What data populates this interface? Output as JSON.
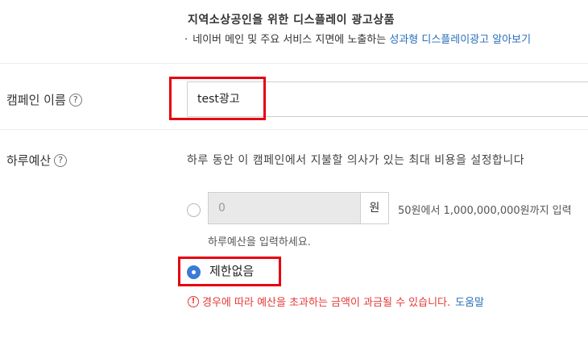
{
  "ad_product": {
    "title": "지역소상공인을 위한 디스플레이 광고상품",
    "desc_prefix": "네이버 메인 및 주요 서비스 지면에 노출하는",
    "desc_link": "성과형 디스플레이광고 알아보기"
  },
  "campaign_name": {
    "label": "캠페인 이름",
    "help": "?",
    "value": "test광고"
  },
  "daily_budget": {
    "label": "하루예산",
    "help": "?",
    "description": "하루 동안 이 캠페인에서 지불할 의사가 있는 최대 비용을 설정합니다",
    "amount_value": "0",
    "unit": "원",
    "range_hint": "50원에서 1,000,000,000원까지 입력",
    "input_hint": "하루예산을 입력하세요.",
    "unlimited_label": "제한없음",
    "unlimited_selected": true,
    "warning_text": "경우에 따라 예산을 초과하는 금액이 과금될 수 있습니다.",
    "warning_icon": "!",
    "help_link": "도움말"
  },
  "colors": {
    "highlight": "#e60012",
    "link": "#2a6ebb",
    "warning": "#e53935",
    "radio_selected": "#3a7bd5"
  }
}
